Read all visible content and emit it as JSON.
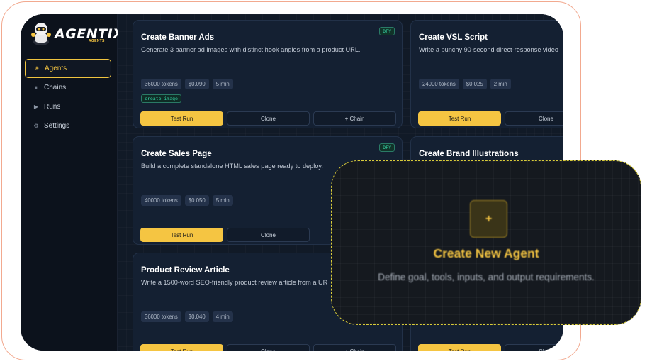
{
  "brand": {
    "name": "AGENTIX",
    "sub": "AGENTS"
  },
  "nav": [
    {
      "icon": "sparkle-icon",
      "glyph": "✳",
      "label": "Agents",
      "active": true
    },
    {
      "icon": "chains-icon",
      "glyph": "⏸",
      "label": "Chains"
    },
    {
      "icon": "play-icon",
      "glyph": "▶",
      "label": "Runs"
    },
    {
      "icon": "gear-icon",
      "glyph": "⚙",
      "label": "Settings"
    }
  ],
  "cards": [
    {
      "title": "Create Banner Ads",
      "desc": "Generate 3 banner ad images with distinct hook angles from a product URL.",
      "badge": "DFY",
      "chips": [
        "36000 tokens",
        "$0.090",
        "5 min"
      ],
      "tool": "create_image",
      "buttons": [
        "Test Run",
        "Clone",
        "+ Chain"
      ]
    },
    {
      "title": "Create VSL Script",
      "desc": "Write a punchy 90-second direct-response video",
      "chips": [
        "24000 tokens",
        "$0.025",
        "2 min"
      ],
      "buttons": [
        "Test Run",
        "Clone"
      ]
    },
    {
      "title": "Create Sales Page",
      "desc": "Build a complete standalone HTML sales page ready to deploy.",
      "badge": "DFY",
      "chips": [
        "40000 tokens",
        "$0.050",
        "5 min"
      ],
      "buttons": [
        "Test Run",
        "Clone"
      ]
    },
    {
      "title": "Create Brand Illustrations",
      "desc": "",
      "chips": [],
      "buttons": []
    },
    {
      "title": "Product Review Article",
      "desc": "Write a 1500-word SEO-friendly product review article from a UR",
      "chips": [
        "36000 tokens",
        "$0.040",
        "4 min"
      ],
      "buttons": [
        "Test Run",
        "Clone",
        "+ Chain"
      ]
    },
    {
      "title": "",
      "desc": "",
      "chips": [],
      "buttons": [
        "Test Run",
        "Clone"
      ]
    }
  ],
  "overlay": {
    "icon": "+",
    "title": "Create New Agent",
    "subtitle": "Define goal, tools, inputs, and output requirements."
  },
  "colors": {
    "accent": "#f5c542",
    "frame": "#f2a98f",
    "dfy": "#36d6a8"
  }
}
